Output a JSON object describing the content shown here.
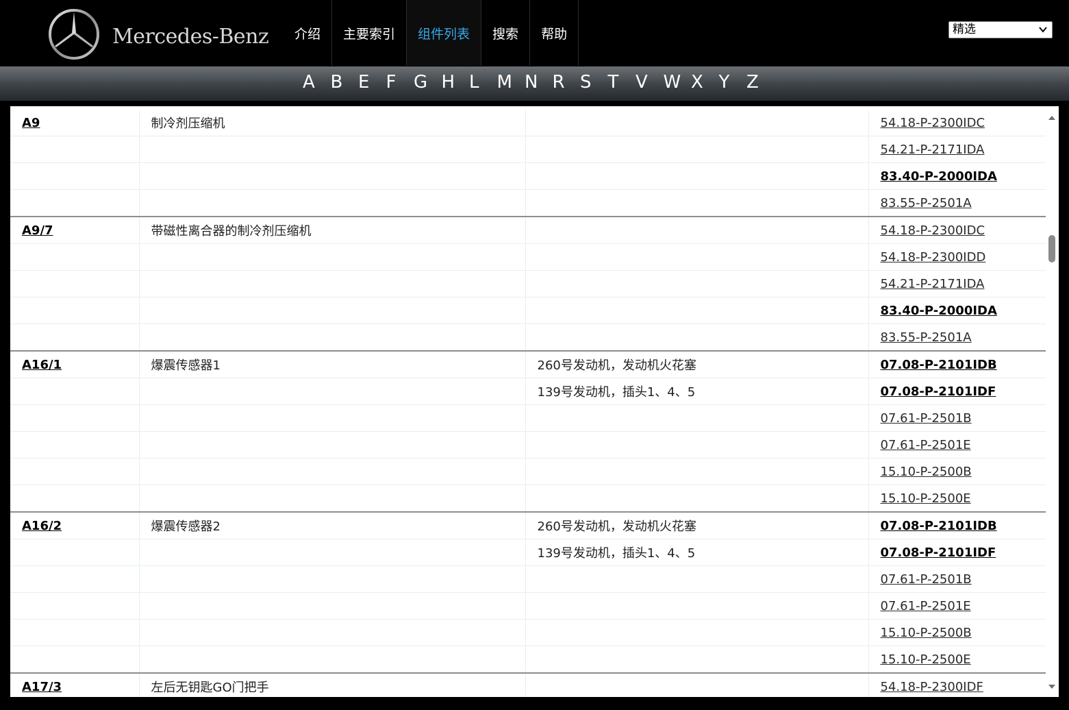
{
  "header": {
    "brand": "Mercedes-Benz",
    "nav": [
      {
        "label": "介绍",
        "active": false
      },
      {
        "label": "主要索引",
        "active": false
      },
      {
        "label": "组件列表",
        "active": true
      },
      {
        "label": "搜索",
        "active": false
      },
      {
        "label": "帮助",
        "active": false
      }
    ],
    "select": {
      "value": "精选"
    }
  },
  "letters": [
    "A",
    "B",
    "E",
    "F",
    "G",
    "H",
    "L",
    "M",
    "N",
    "R",
    "S",
    "T",
    "V",
    "W",
    "X",
    "Y",
    "Z"
  ],
  "colors": {
    "active_nav": "#3aa8e6",
    "header_bg": "#000000"
  },
  "components": [
    {
      "code": "A9",
      "name": "制冷剂压缩机",
      "rows": [
        {
          "note": "",
          "doc": "54.18-P-2300IDC",
          "bold": false
        },
        {
          "note": "",
          "doc": "54.21-P-2171IDA",
          "bold": false
        },
        {
          "note": "",
          "doc": "83.40-P-2000IDA",
          "bold": true
        },
        {
          "note": "",
          "doc": "83.55-P-2501A",
          "bold": false
        }
      ]
    },
    {
      "code": "A9/7",
      "name": "带磁性离合器的制冷剂压缩机",
      "rows": [
        {
          "note": "",
          "doc": "54.18-P-2300IDC",
          "bold": false
        },
        {
          "note": "",
          "doc": "54.18-P-2300IDD",
          "bold": false
        },
        {
          "note": "",
          "doc": "54.21-P-2171IDA",
          "bold": false
        },
        {
          "note": "",
          "doc": "83.40-P-2000IDA",
          "bold": true
        },
        {
          "note": "",
          "doc": "83.55-P-2501A",
          "bold": false
        }
      ]
    },
    {
      "code": "A16/1",
      "name": "爆震传感器1",
      "rows": [
        {
          "note": "260号发动机，发动机火花塞",
          "doc": "07.08-P-2101IDB",
          "bold": true
        },
        {
          "note": "139号发动机，插头1、4、5",
          "doc": "07.08-P-2101IDF",
          "bold": true
        },
        {
          "note": "",
          "doc": "07.61-P-2501B",
          "bold": false
        },
        {
          "note": "",
          "doc": "07.61-P-2501E",
          "bold": false
        },
        {
          "note": "",
          "doc": "15.10-P-2500B",
          "bold": false
        },
        {
          "note": "",
          "doc": "15.10-P-2500E",
          "bold": false
        }
      ]
    },
    {
      "code": "A16/2",
      "name": "爆震传感器2",
      "rows": [
        {
          "note": "260号发动机，发动机火花塞",
          "doc": "07.08-P-2101IDB",
          "bold": true
        },
        {
          "note": "139号发动机，插头1、4、5",
          "doc": "07.08-P-2101IDF",
          "bold": true
        },
        {
          "note": "",
          "doc": "07.61-P-2501B",
          "bold": false
        },
        {
          "note": "",
          "doc": "07.61-P-2501E",
          "bold": false
        },
        {
          "note": "",
          "doc": "15.10-P-2500B",
          "bold": false
        },
        {
          "note": "",
          "doc": "15.10-P-2500E",
          "bold": false
        }
      ]
    },
    {
      "code": "A17/3",
      "name": "左后无钥匙GO门把手",
      "rows": [
        {
          "note": "",
          "doc": "54.18-P-2300IDF",
          "bold": false
        }
      ]
    }
  ]
}
